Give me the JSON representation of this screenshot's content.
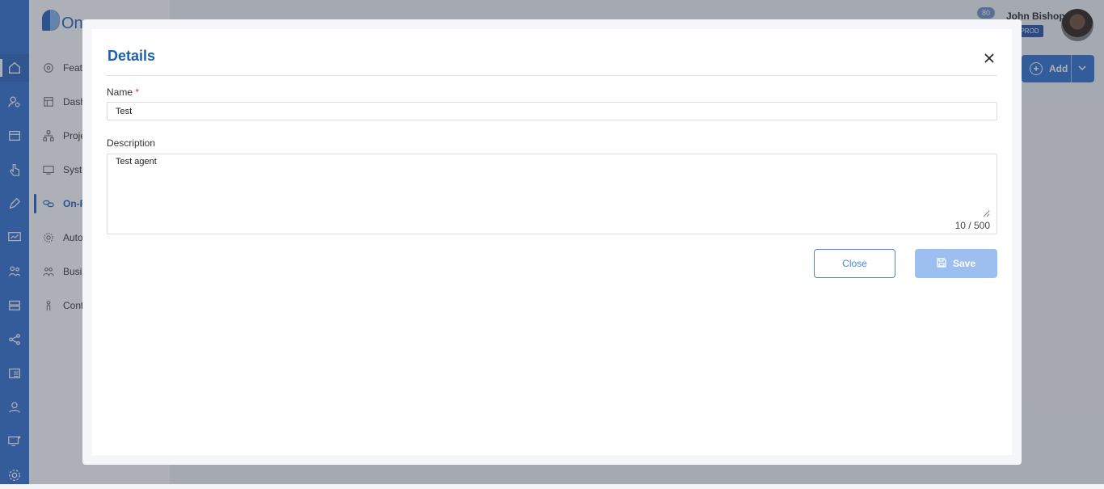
{
  "app": {
    "logo_text": "One",
    "page_title_partial": "",
    "notification_count": "80",
    "user_name": "John Bishop",
    "env_badge": "PROD",
    "add_label": "Add"
  },
  "rail_icons": [
    "home-icon",
    "user-search-icon",
    "store-icon",
    "touch-icon",
    "pen-icon",
    "monitor-chart-icon",
    "people-icon",
    "server-icon",
    "share-icon",
    "list-icon",
    "agent-icon",
    "remote-desktop-icon",
    "settings-icon"
  ],
  "nav": {
    "items": [
      {
        "label": "Featu",
        "icon": "gear-star-icon"
      },
      {
        "label": "Dash",
        "icon": "dashboard-icon"
      },
      {
        "label": "Proje",
        "icon": "hierarchy-icon"
      },
      {
        "label": "Syste",
        "icon": "system-icon"
      },
      {
        "label": "On-P",
        "icon": "link-icon"
      },
      {
        "label": "Auto",
        "icon": "cog-icon"
      },
      {
        "label": "Busi",
        "icon": "people-icon"
      },
      {
        "label": "Cont",
        "icon": "person-icon"
      }
    ]
  },
  "modal": {
    "title": "Details",
    "name_label": "Name",
    "required_mark": "*",
    "name_value": "Test",
    "description_label": "Description",
    "description_value": "Test agent",
    "counter": "10 / 500",
    "close_label": "Close",
    "save_label": "Save"
  },
  "colors": {
    "brand": "#1f5fb8",
    "rail": "#2f6fd0",
    "save_disabled": "#9dbff0"
  }
}
